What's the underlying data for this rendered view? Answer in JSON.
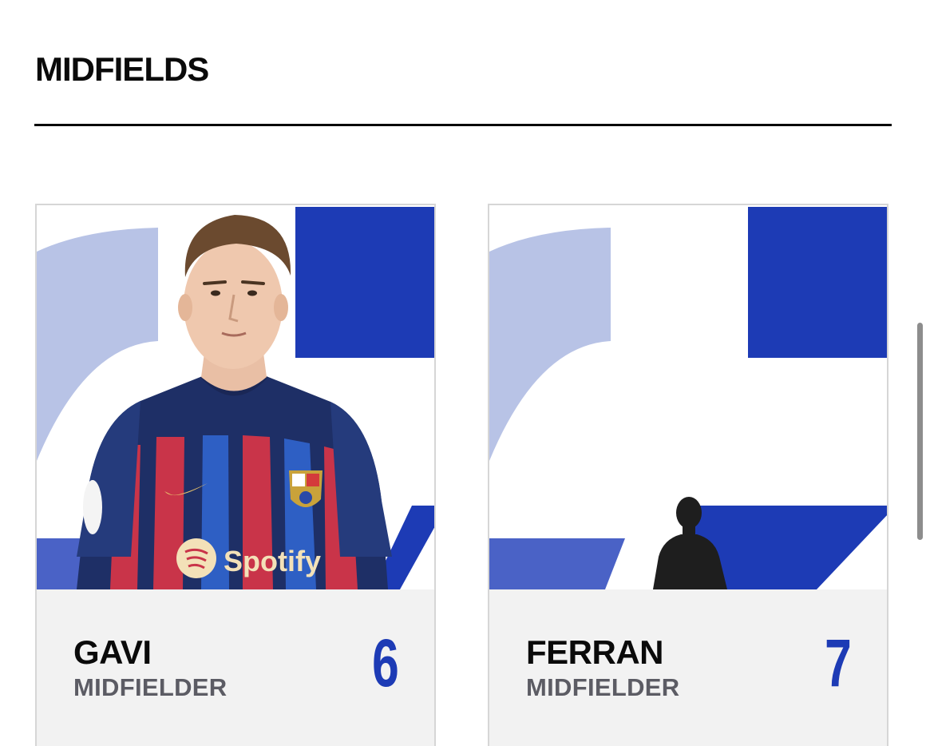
{
  "section": {
    "title": "MIDFIELDS"
  },
  "colors": {
    "accent_blue": "#1d3bb5",
    "light_blue": "#b8c3e6",
    "card_footer_bg": "#f2f2f2",
    "role_gray": "#5c5c64"
  },
  "players": [
    {
      "name": "GAVI",
      "role": "MIDFIELDER",
      "number": "6",
      "photo": "player-photo",
      "sponsor": "Spotify"
    },
    {
      "name": "FERRAN",
      "role": "MIDFIELDER",
      "number": "7",
      "photo": "silhouette-placeholder"
    }
  ]
}
